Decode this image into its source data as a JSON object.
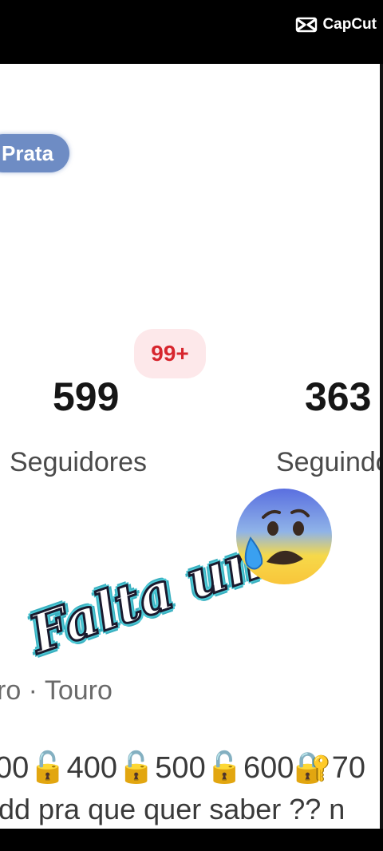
{
  "watermark": {
    "brand": "CapCut",
    "logo_icon": "capcut-logo-icon"
  },
  "profile": {
    "badge": "Prata",
    "notification_badge": "99+",
    "followers": {
      "count": "599",
      "label": "Seguidores"
    },
    "following": {
      "count": "363",
      "label": "Seguindo"
    },
    "zodiac_line": "ro  ·  Touro",
    "bio_line1": "00🔓400🔓500🔓600🔐70",
    "bio_line2": "dd pra que quer saber ?? n"
  },
  "overlay": {
    "caption": "Falta um",
    "emoji": "anxious-face-with-sweat-icon"
  },
  "colors": {
    "badge_bg": "#6e8cc4",
    "notif_bg": "#fde8ea",
    "notif_text": "#d7262e",
    "caption_outline": "#4cc9d6"
  }
}
